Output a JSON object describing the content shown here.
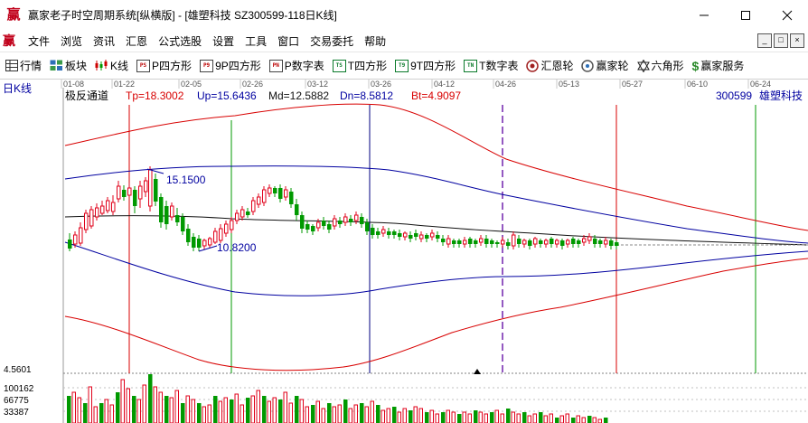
{
  "window": {
    "logo": "赢",
    "title": "赢家老子时空周期系统[纵横版] - [雄塑科技  SZ300599-118日K线]",
    "min_glyph": "—",
    "max_glyph": "☐",
    "close_glyph": "✕"
  },
  "menu": {
    "logo": "赢",
    "items": [
      "文件",
      "浏览",
      "资讯",
      "汇恩",
      "公式选股",
      "设置",
      "工具",
      "窗口",
      "交易委托",
      "帮助"
    ],
    "mdi": [
      "_",
      "□",
      "×"
    ]
  },
  "toolbar": [
    {
      "label": "行情",
      "icon": "grid-icon",
      "glyph": "▦"
    },
    {
      "label": "板块",
      "icon": "blocks-icon",
      "glyph": "▣"
    },
    {
      "label": "K线",
      "icon": "candles-icon",
      "glyph": "⫶"
    },
    {
      "label": "P四方形",
      "icon": "ps-icon",
      "glyph": "PS"
    },
    {
      "label": "9P四方形",
      "icon": "p9-icon",
      "glyph": "P9"
    },
    {
      "label": "P数字表",
      "icon": "pn-icon",
      "glyph": "PN"
    },
    {
      "label": "T四方形",
      "icon": "ts-icon",
      "glyph": "TS"
    },
    {
      "label": "9T四方形",
      "icon": "t9-icon",
      "glyph": "T9"
    },
    {
      "label": "T数字表",
      "icon": "tn-icon",
      "glyph": "TN"
    },
    {
      "label": "汇恩轮",
      "icon": "wheel-icon",
      "glyph": "◎"
    },
    {
      "label": "赢家轮",
      "icon": "win-wheel-icon",
      "glyph": "赢"
    },
    {
      "label": "六角形",
      "icon": "hexagon-icon",
      "glyph": "✡"
    },
    {
      "label": "赢家服务",
      "icon": "dollar-icon",
      "glyph": "$"
    }
  ],
  "chart_header": {
    "period": "日K线",
    "indicator": "极反通道",
    "tp": "Tp=18.3002",
    "up": "Up=15.6436",
    "md": "Md=12.5882",
    "dn": "Dn=8.5812",
    "bt": "Bt=4.9097",
    "code": "300599",
    "name": "雄塑科技"
  },
  "dates": [
    "01-08",
    "01-22",
    "02-05",
    "02-26",
    "03-12",
    "03-26",
    "04-12",
    "04-26",
    "05-13",
    "05-27",
    "06-10",
    "06-24"
  ],
  "annotations": {
    "high": "15.1500",
    "low": "10.8200"
  },
  "volume_axis": [
    "4.5601",
    "100162",
    "66775",
    "33387"
  ],
  "colors": {
    "up": "#e0001a",
    "down": "#009900",
    "outer": "#d80000",
    "middle": "#0000a0",
    "center": "#111111",
    "dash": "#5a00a0"
  }
}
